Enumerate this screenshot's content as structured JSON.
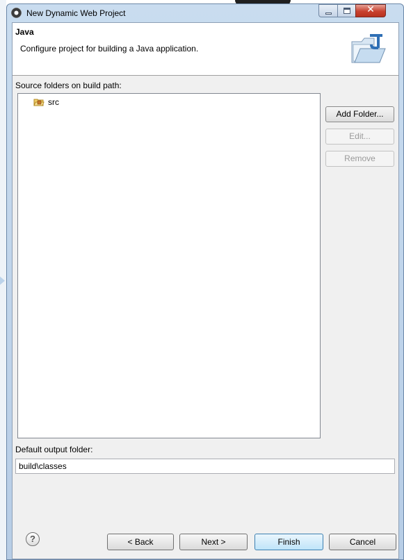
{
  "window": {
    "title": "New Dynamic Web Project"
  },
  "header": {
    "title": "Java",
    "description": "Configure project for building a Java application."
  },
  "source": {
    "label": "Source folders on build path:",
    "items": [
      {
        "label": "src"
      }
    ]
  },
  "side_buttons": {
    "add_folder": "Add Folder...",
    "edit": "Edit...",
    "remove": "Remove"
  },
  "output": {
    "label": "Default output folder:",
    "value": "build\\classes"
  },
  "footer": {
    "back": "< Back",
    "next": "Next >",
    "finish": "Finish",
    "cancel": "Cancel",
    "help": "?"
  },
  "icons": {
    "app": "eclipse-icon",
    "header": "java-folder-icon",
    "src": "package-folder-icon",
    "help": "help-icon"
  },
  "colors": {
    "finish_border": "#3c7fb1",
    "close_button": "#c8412f"
  }
}
